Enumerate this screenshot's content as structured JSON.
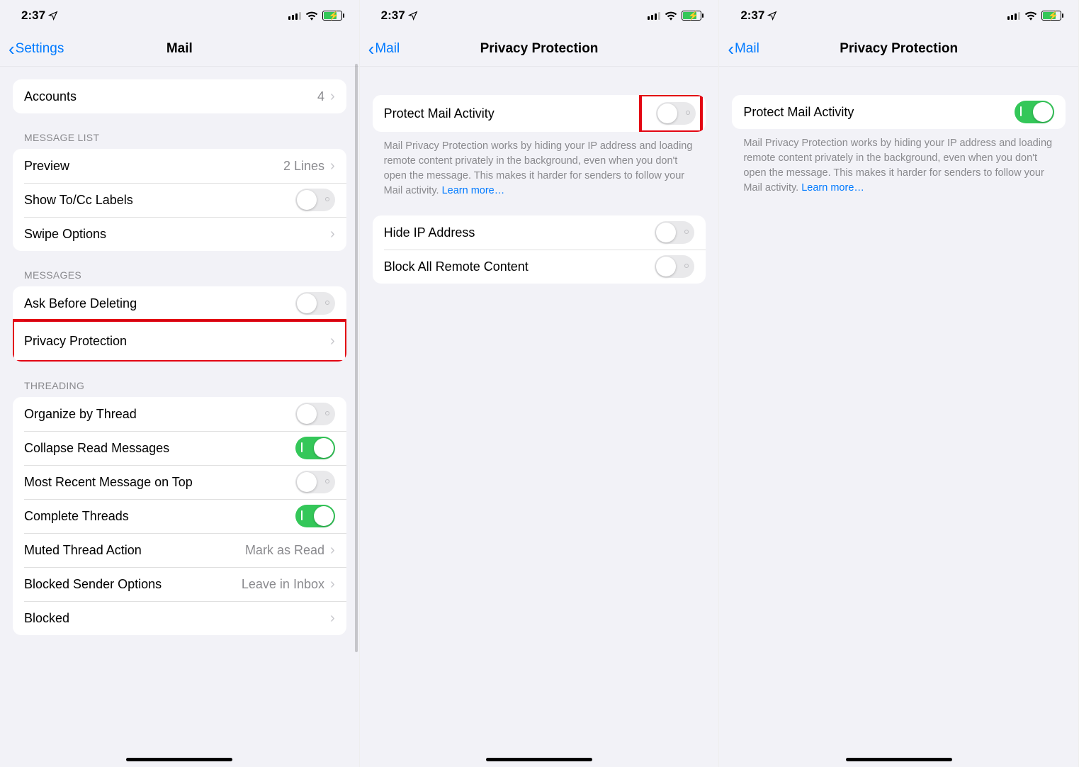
{
  "status": {
    "time": "2:37",
    "location_icon": "◤"
  },
  "screen1": {
    "back": "Settings",
    "title": "Mail",
    "accounts": {
      "label": "Accounts",
      "value": "4"
    },
    "headers": {
      "message_list": "MESSAGE LIST",
      "messages": "MESSAGES",
      "threading": "THREADING"
    },
    "message_list": {
      "preview": {
        "label": "Preview",
        "value": "2 Lines"
      },
      "show_tocc": {
        "label": "Show To/Cc Labels",
        "on": false
      },
      "swipe": {
        "label": "Swipe Options"
      }
    },
    "messages": {
      "ask_before_deleting": {
        "label": "Ask Before Deleting",
        "on": false
      },
      "privacy_protection": {
        "label": "Privacy Protection"
      }
    },
    "threading": {
      "organize": {
        "label": "Organize by Thread",
        "on": false
      },
      "collapse": {
        "label": "Collapse Read Messages",
        "on": true
      },
      "most_recent": {
        "label": "Most Recent Message on Top",
        "on": false
      },
      "complete": {
        "label": "Complete Threads",
        "on": true
      },
      "muted": {
        "label": "Muted Thread Action",
        "value": "Mark as Read"
      },
      "blocked_sender": {
        "label": "Blocked Sender Options",
        "value": "Leave in Inbox"
      },
      "blocked": {
        "label": "Blocked"
      }
    }
  },
  "screen2": {
    "back": "Mail",
    "title": "Privacy Protection",
    "protect": {
      "label": "Protect Mail Activity",
      "on": false
    },
    "footer": "Mail Privacy Protection works by hiding your IP address and loading remote content privately in the background, even when you don't open the message. This makes it harder for senders to follow your Mail activity. ",
    "learn_more": "Learn more…",
    "hide_ip": {
      "label": "Hide IP Address",
      "on": false
    },
    "block_remote": {
      "label": "Block All Remote Content",
      "on": false
    }
  },
  "screen3": {
    "back": "Mail",
    "title": "Privacy Protection",
    "protect": {
      "label": "Protect Mail Activity",
      "on": true
    },
    "footer": "Mail Privacy Protection works by hiding your IP address and loading remote content privately in the background, even when you don't open the message. This makes it harder for senders to follow your Mail activity. ",
    "learn_more": "Learn more…"
  }
}
